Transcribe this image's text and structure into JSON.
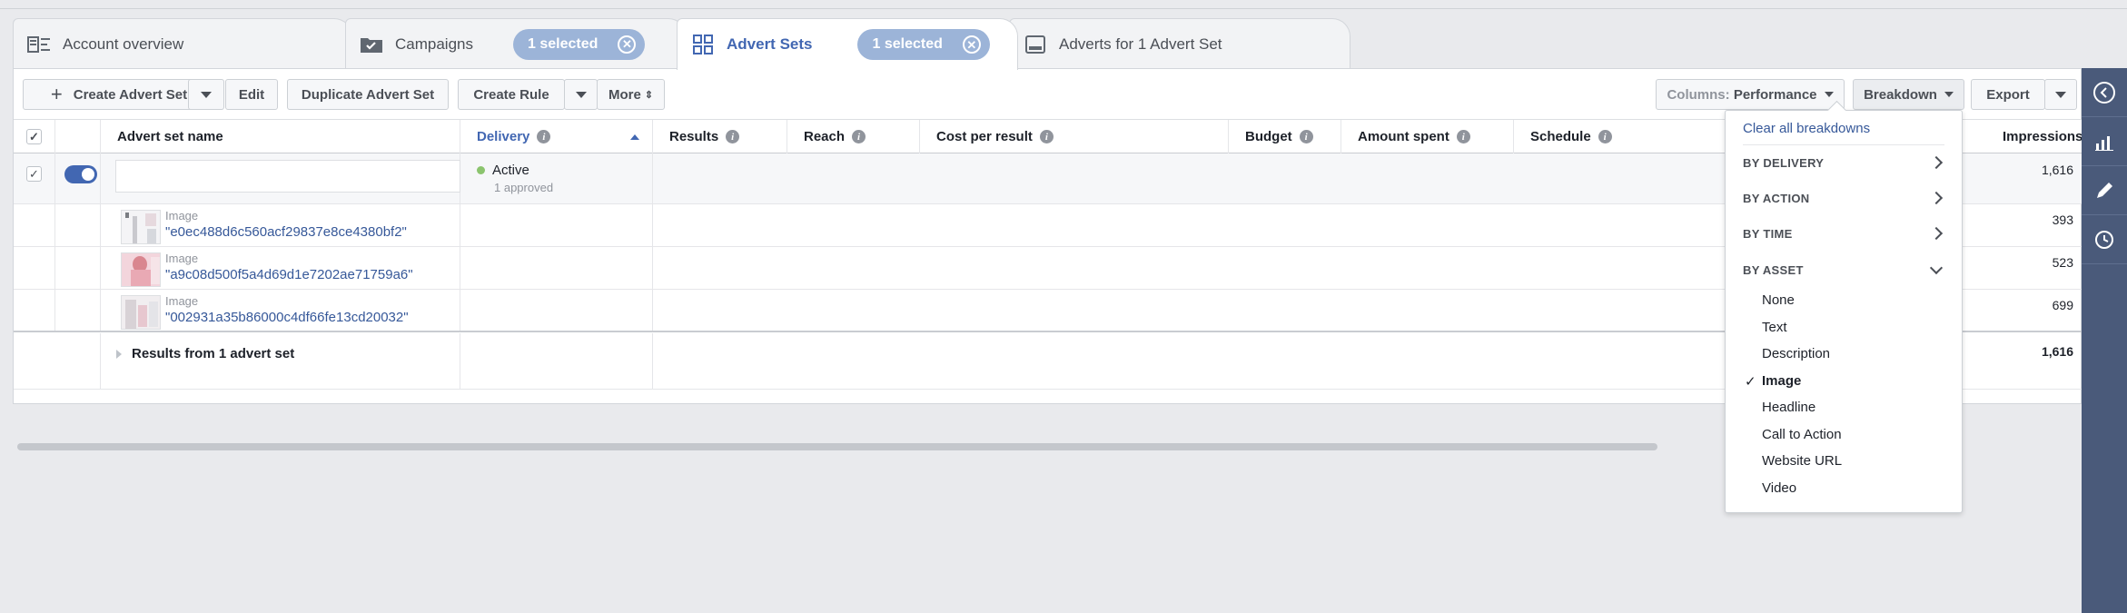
{
  "tabs": [
    {
      "label": "Account overview",
      "icon": "account-overview-icon"
    },
    {
      "label": "Campaigns",
      "icon": "folder-check-icon",
      "pill": "1 selected"
    },
    {
      "label": "Advert Sets",
      "icon": "grid-icon",
      "pill": "1 selected"
    },
    {
      "label": "Adverts for 1 Advert Set",
      "icon": "advert-icon"
    }
  ],
  "toolbar": {
    "create": "Create Advert Set",
    "edit": "Edit",
    "duplicate": "Duplicate Advert Set",
    "create_rule": "Create Rule",
    "more": "More",
    "columns_prefix": "Columns:",
    "columns_value": "Performance",
    "breakdown": "Breakdown",
    "export": "Export"
  },
  "columns": {
    "name": "Advert set name",
    "delivery": "Delivery",
    "results": "Results",
    "reach": "Reach",
    "cost": "Cost per result",
    "budget": "Budget",
    "amount": "Amount spent",
    "schedule": "Schedule",
    "impressions": "Impressions"
  },
  "advert_set": {
    "status": "Active",
    "status_sub": "1 approved",
    "impressions": "1,616"
  },
  "images": [
    {
      "type": "Image",
      "id": "\"e0ec488d6c560acf29837e8ce4380bf2\"",
      "impressions": "393"
    },
    {
      "type": "Image",
      "id": "\"a9c08d500f5a4d69d1e7202ae71759a6\"",
      "impressions": "523"
    },
    {
      "type": "Image",
      "id": "\"002931a35b86000c4df66fe13cd20032\"",
      "impressions": "699"
    }
  ],
  "results_row": {
    "label": "Results from 1 advert set",
    "impressions": "1,616"
  },
  "breakdown_menu": {
    "clear": "Clear all breakdowns",
    "groups": [
      "BY DELIVERY",
      "BY ACTION",
      "BY TIME",
      "BY ASSET"
    ],
    "asset_options": [
      "None",
      "Text",
      "Description",
      "Image",
      "Headline",
      "Call to Action",
      "Website URL",
      "Video"
    ],
    "selected": "Image"
  },
  "colors": {
    "accent": "#4267b2",
    "pill": "#9cb4d8",
    "rail": "#4a5a7a",
    "active_dot": "#8bc46e",
    "link": "#365899"
  }
}
